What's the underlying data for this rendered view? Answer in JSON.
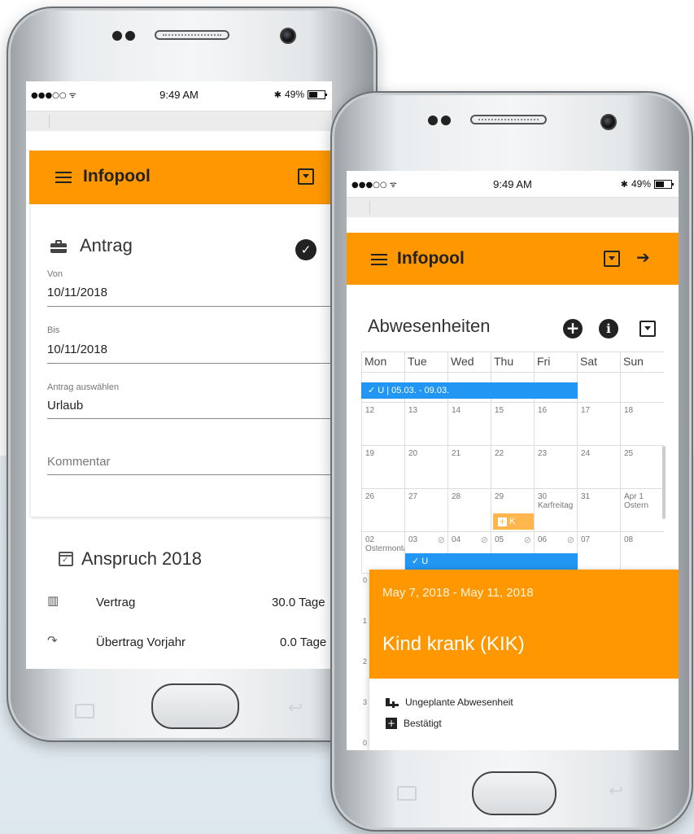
{
  "status": {
    "time": "9:49 AM",
    "battery": "49%",
    "signal": "●●●○○ ᯤ",
    "bt": "✱"
  },
  "back_phone": {
    "app_title": "Infopool",
    "antrag": {
      "title": "Antrag",
      "von_label": "Von",
      "von_value": "10/11/2018",
      "bis_label": "Bis",
      "bis_value": "10/11/2018",
      "type_label": "Antrag auswählen",
      "type_value": "Urlaub",
      "comment_placeholder": "Kommentar"
    },
    "anspruch": {
      "title": "Anspruch 2018",
      "rows": [
        {
          "icon": "book-icon",
          "label": "Vertrag",
          "value": "30.0 Tage"
        },
        {
          "icon": "redo-icon",
          "label": "Übertrag Vorjahr",
          "value": "0.0 Tage"
        }
      ]
    }
  },
  "front_phone": {
    "app_title": "Infopool",
    "section_title": "Abwesenheiten",
    "weekdays": [
      "Mon",
      "Tue",
      "Wed",
      "Thu",
      "Fri",
      "Sat",
      "Sun"
    ],
    "weeks": [
      [
        "",
        "",
        "",
        "",
        "",
        "",
        ""
      ],
      [
        "12",
        "13",
        "14",
        "15",
        "16",
        "17",
        "18"
      ],
      [
        "19",
        "20",
        "21",
        "22",
        "23",
        "24",
        "25"
      ],
      [
        "26",
        "27",
        "28",
        "29",
        "30",
        "31",
        "Apr 1"
      ],
      [
        "02",
        "03",
        "04",
        "05",
        "06",
        "07",
        "08"
      ]
    ],
    "holidays": {
      "fri_30": "Karfreitag",
      "apr_1": "Ostern",
      "mon_02": "Ostermontag"
    },
    "events": {
      "vacation_1": "✓ U | 05.03. - 09.03.",
      "sick_k": "K",
      "vacation_2": "✓ U"
    },
    "left_stub_numbers": [
      "0",
      "1",
      "2",
      "3",
      "0"
    ],
    "detail": {
      "date_range": "May 7, 2018 - May 11, 2018",
      "title": "Kind krank (KIK)",
      "line1": "Ungeplante Abwesenheit",
      "line2": "Bestätigt"
    }
  },
  "colors": {
    "accent": "#ff9800",
    "event_blue": "#2196f3",
    "event_orange": "#ffb74d"
  }
}
